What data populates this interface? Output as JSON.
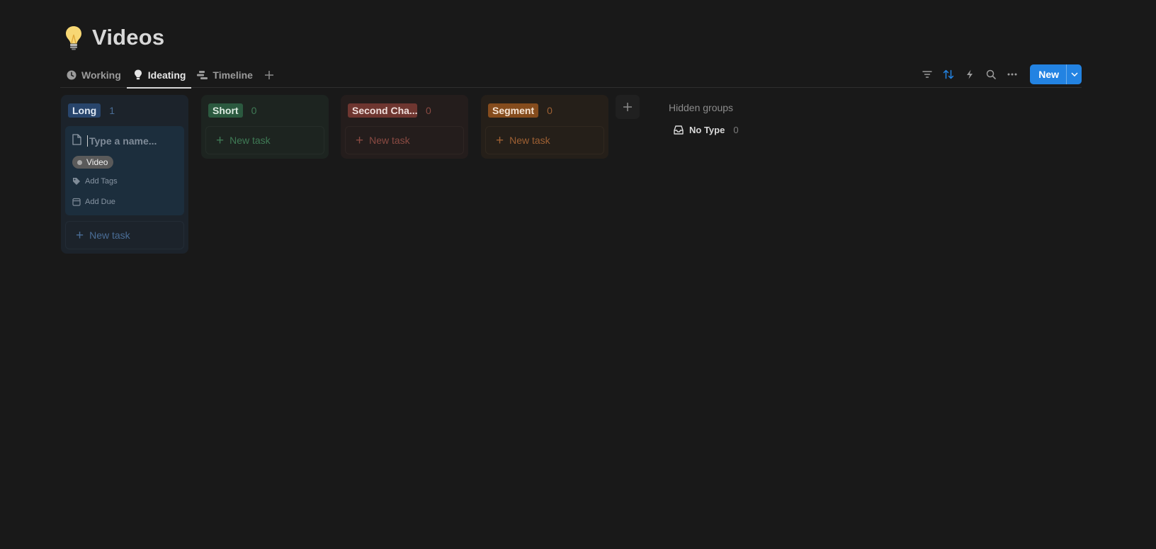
{
  "page": {
    "title": "Videos",
    "icon": "lightbulb-icon"
  },
  "tabs": [
    {
      "label": "Working",
      "icon": "clock-icon",
      "active": false
    },
    {
      "label": "Ideating",
      "icon": "lightbulb-icon",
      "active": true
    },
    {
      "label": "Timeline",
      "icon": "timeline-icon",
      "active": false
    }
  ],
  "toolbar": {
    "icons": [
      "filter-icon",
      "sort-icon",
      "lightning-icon",
      "search-icon",
      "more-icon"
    ],
    "new_label": "New",
    "accent": "#2383e2"
  },
  "columns": [
    {
      "label": "Long",
      "count": "1",
      "pill_bg": "#28456c",
      "color": "#4a6d96"
    },
    {
      "label": "Short",
      "count": "0",
      "pill_bg": "#2b593f",
      "color": "#3f7a55"
    },
    {
      "label": "Second Cha...",
      "count": "0",
      "pill_bg": "#6e3630",
      "color": "#8a4a42"
    },
    {
      "label": "Segment",
      "count": "0",
      "pill_bg": "#854c1d",
      "color": "#9e6033"
    }
  ],
  "new_task_label": "New task",
  "card": {
    "name_placeholder": "Type a name...",
    "tag": "Video",
    "add_tags": "Add Tags",
    "add_due": "Add Due"
  },
  "hidden_groups": {
    "title": "Hidden groups",
    "items": [
      {
        "label": "No Type",
        "count": "0"
      }
    ]
  }
}
